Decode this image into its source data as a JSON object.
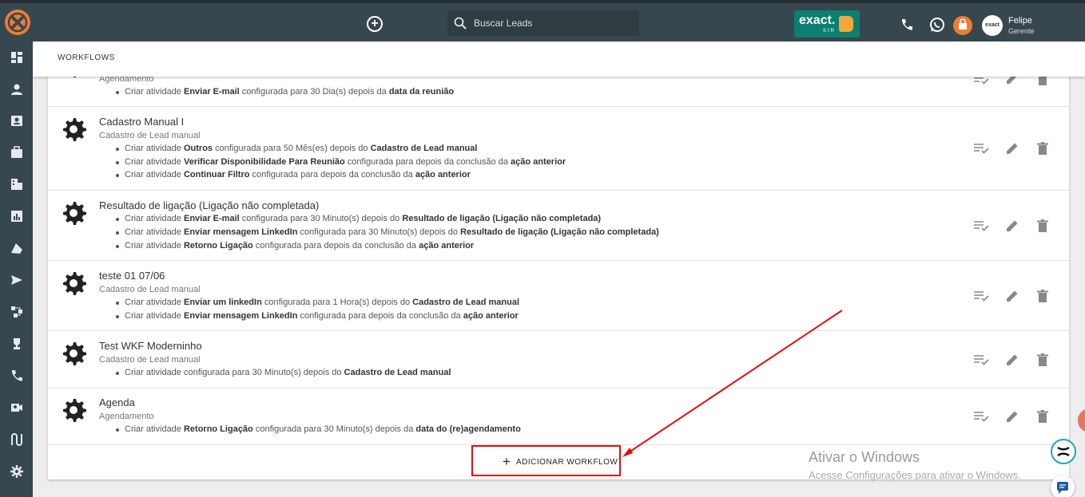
{
  "header": {
    "search_placeholder": "Buscar Leads",
    "brand_text": "exact.",
    "brand_sub": "SIR",
    "avatar_text": "exact",
    "user_name": "Felipe",
    "user_role": "Gerente"
  },
  "tabs": {
    "active": "WORKFLOWS"
  },
  "workflows": [
    {
      "title": "",
      "subtitle": "Agendamento",
      "actions": [
        {
          "pre": "Criar atividade ",
          "name": "Enviar E-mail",
          "mid": " configurada para 30 Dia(s) depois da ",
          "ref": "data da reunião"
        }
      ]
    },
    {
      "title": "Cadastro Manual I",
      "subtitle": "Cadastro de Lead manual",
      "actions": [
        {
          "pre": "Criar atividade ",
          "name": "Outros",
          "mid": " configurada para 50 Mês(es) depois do ",
          "ref": "Cadastro de Lead manual"
        },
        {
          "pre": "Criar atividade ",
          "name": "Verificar Disponibilidade Para Reunião",
          "mid": " configurada para depois da conclusão da ",
          "ref": "ação anterior"
        },
        {
          "pre": "Criar atividade ",
          "name": "Continuar Filtro",
          "mid": " configurada para depois da conclusão da ",
          "ref": "ação anterior"
        }
      ]
    },
    {
      "title": "Resultado de ligação (Ligação não completada)",
      "subtitle": "",
      "actions": [
        {
          "pre": "Criar atividade ",
          "name": "Enviar E-mail",
          "mid": " configurada para 30 Minuto(s) depois do ",
          "ref": "Resultado de ligação (Ligação não completada)"
        },
        {
          "pre": "Criar atividade ",
          "name": "Enviar mensagem LinkedIn",
          "mid": " configurada para 30 Minuto(s) depois do ",
          "ref": "Resultado de ligação (Ligação não completada)"
        },
        {
          "pre": "Criar atividade ",
          "name": "Retorno Ligação",
          "mid": " configurada para depois da conclusão da ",
          "ref": "ação anterior"
        }
      ]
    },
    {
      "title": "teste 01 07/06",
      "subtitle": "Cadastro de Lead manual",
      "actions": [
        {
          "pre": "Criar atividade ",
          "name": "Enviar um linkedIn",
          "mid": " configurada para 1 Hora(s) depois do ",
          "ref": "Cadastro de Lead manual"
        },
        {
          "pre": "Criar atividade ",
          "name": "Enviar mensagem LinkedIn",
          "mid": " configurada para depois da conclusão da ",
          "ref": "ação anterior"
        }
      ]
    },
    {
      "title": "Test WKF Moderninho",
      "subtitle": "Cadastro de Lead manual",
      "actions": [
        {
          "pre": "Criar atividade",
          "name": "",
          "mid": " configurada para 30 Minuto(s) depois do ",
          "ref": "Cadastro de Lead manual"
        }
      ]
    },
    {
      "title": "Agenda",
      "subtitle": "Agendamento",
      "actions": [
        {
          "pre": "Criar atividade ",
          "name": "Retorno Ligação",
          "mid": " configurada para 30 Minuto(s) depois da ",
          "ref": "data do (re)agendamento"
        }
      ]
    }
  ],
  "add_button": {
    "label": "ADICIONAR WORKFLOW"
  },
  "watermark": {
    "title": "Ativar o Windows",
    "subtitle": "Acesse Configurações para ativar o Windows."
  },
  "colors": {
    "topbar": "#37474f",
    "brand": "#f07c34",
    "exact_green": "#0c7f70",
    "highlight": "#e01010"
  }
}
